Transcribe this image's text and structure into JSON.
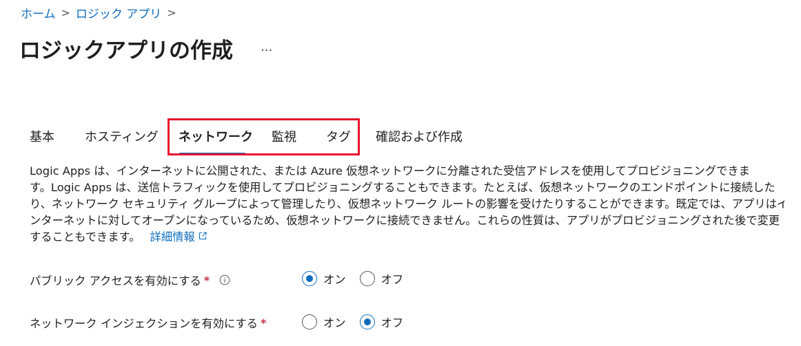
{
  "breadcrumb": {
    "items": [
      "ホーム",
      "ロジック アプリ"
    ],
    "separator": ">"
  },
  "header": {
    "title": "ロジックアプリの作成",
    "more_label": "..."
  },
  "tabs": [
    {
      "label": "基本",
      "active": false
    },
    {
      "label": "ホスティング",
      "active": false
    },
    {
      "label": "ネットワーク",
      "active": true
    },
    {
      "label": "監視",
      "active": false
    },
    {
      "label": "タグ",
      "active": false
    },
    {
      "label": "確認および作成",
      "active": false
    }
  ],
  "description": {
    "lines": [
      "Logic Apps は、インターネットに公開された、または Azure 仮想ネットワークに分離された受信アドレスを使用してプロビジョニングできま",
      "す。Logic Apps は、送信トラフィックを使用してプロビジョニングすることもできます。たとえば、仮想ネットワークのエンドポイントに接続した",
      "り、ネットワーク セキュリティ グループによって管理したり、仮想ネットワーク ルートの影響を受けたりすることができます。既定では、アプリはイ",
      "ンターネットに対してオープンになっているため、仮想ネットワークに接続できません。これらの性質は、アプリがプロビジョニングされた後で変更",
      "することもできます。"
    ],
    "link_label": "詳細情報"
  },
  "fields": {
    "public_access": {
      "label": "パブリック アクセスを有効にする",
      "required_mark": "*",
      "options": [
        {
          "label": "オン",
          "checked": true
        },
        {
          "label": "オフ",
          "checked": false
        }
      ]
    },
    "network_injection": {
      "label": "ネットワーク インジェクションを有効にする",
      "required_mark": "*",
      "options": [
        {
          "label": "オン",
          "checked": false
        },
        {
          "label": "オフ",
          "checked": true
        }
      ]
    }
  },
  "colors": {
    "accent": "#0f6cbd",
    "highlight_border": "#e8112d",
    "required": "#c4314b"
  }
}
